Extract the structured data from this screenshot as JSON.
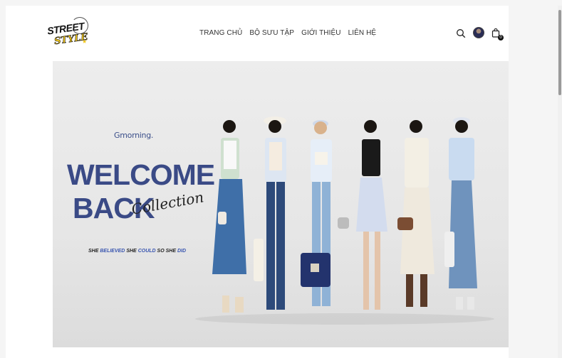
{
  "brand": {
    "line1": "STREET",
    "line2": "STYLE"
  },
  "nav": {
    "items": [
      {
        "label": "TRANG CHỦ"
      },
      {
        "label": "BỘ SƯU TẬP"
      },
      {
        "label": "GIỚI THIỆU"
      },
      {
        "label": "LIÊN HỆ"
      }
    ]
  },
  "cart": {
    "count": "0"
  },
  "hero": {
    "greeting": "Gmorning.",
    "title_line1": "WELCOME",
    "title_line2": "BACK",
    "script_word": "Collection",
    "tagline": {
      "w1": "SHE",
      "w2": "BELIEVED",
      "w3": "SHE",
      "w4": "COULD",
      "w5": "SO SHE",
      "w6": "DID"
    }
  },
  "colors": {
    "accent": "#3a4a86",
    "highlight": "#3a56b0",
    "logo_yellow": "#f0c419"
  },
  "icons": [
    "search-icon",
    "avatar",
    "shopping-bag-icon"
  ]
}
